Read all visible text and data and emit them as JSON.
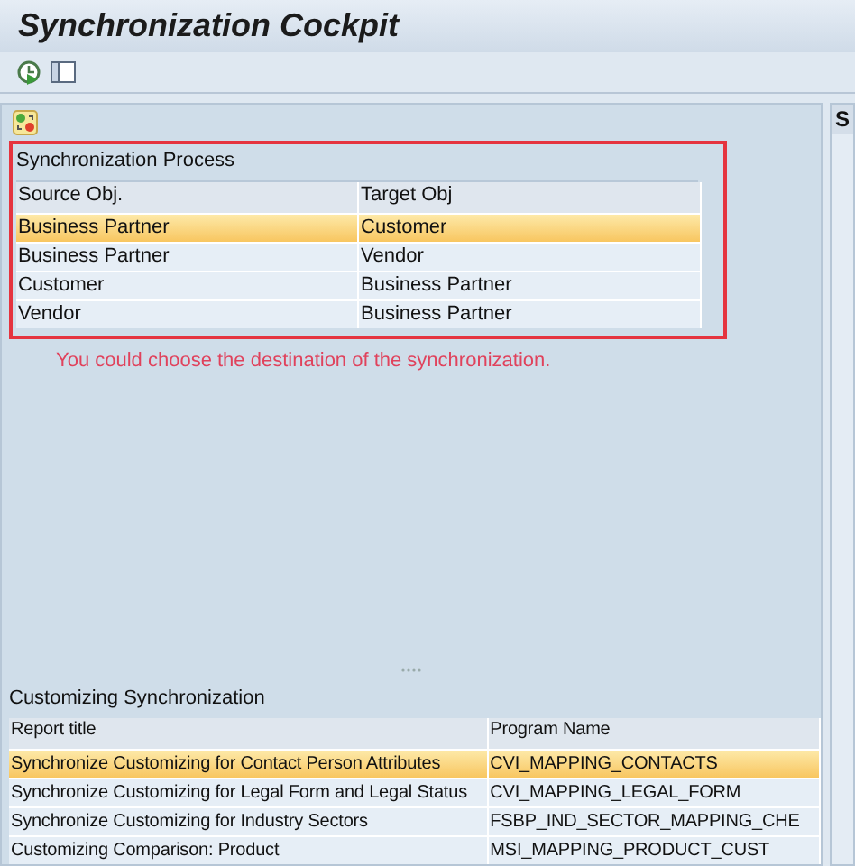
{
  "window": {
    "title": "Synchronization Cockpit"
  },
  "sync_process": {
    "title": "Synchronization Process",
    "highlighted": true,
    "columns": [
      "Source Obj.",
      "Target Obj"
    ],
    "rows": [
      {
        "cells": [
          "Business Partner",
          "Customer"
        ],
        "selected": true
      },
      {
        "cells": [
          "Business Partner",
          "Vendor"
        ],
        "selected": false
      },
      {
        "cells": [
          "Customer",
          "Business Partner"
        ],
        "selected": false
      },
      {
        "cells": [
          "Vendor",
          "Business Partner"
        ],
        "selected": false
      }
    ]
  },
  "hint": "You could choose the destination of the synchronization.",
  "customizing": {
    "title": "Customizing Synchronization",
    "columns": [
      "Report title",
      "Program Name"
    ],
    "rows": [
      {
        "cells": [
          "Synchronize Customizing for Contact Person Attributes",
          "CVI_MAPPING_CONTACTS"
        ],
        "selected": true
      },
      {
        "cells": [
          "Synchronize Customizing for Legal Form and Legal Status",
          "CVI_MAPPING_LEGAL_FORM"
        ],
        "selected": false
      },
      {
        "cells": [
          "Synchronize Customizing for Industry Sectors",
          "FSBP_IND_SECTOR_MAPPING_CHE"
        ],
        "selected": false
      },
      {
        "cells": [
          "Customizing Comparison: Product",
          "MSI_MAPPING_PRODUCT_CUST"
        ],
        "selected": false
      }
    ]
  },
  "side_panel": {
    "title": "S"
  }
}
